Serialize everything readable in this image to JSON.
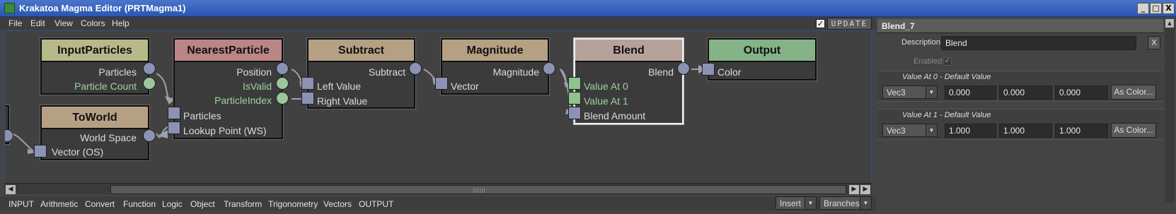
{
  "window": {
    "title": "Krakatoa Magma Editor (PRTMagma1)",
    "min_label": "_",
    "max_label": "□",
    "close_label": "X"
  },
  "menu": [
    "File",
    "Edit",
    "View",
    "Colors",
    "Help"
  ],
  "update": {
    "checked": true,
    "check_mark": "✓",
    "label": "UPDATE"
  },
  "colors": {
    "input_header": "#b8b98a",
    "nearest_header": "#bb8585",
    "subtract_header": "#b6a084",
    "magnitude_header": "#b6a084",
    "blend_header": "#b6a29a",
    "output_header": "#86b288",
    "toworld_header": "#b6a084"
  },
  "nodes": {
    "input_particles": {
      "title": "InputParticles",
      "outputs": [
        "Particles",
        "Particle Count"
      ]
    },
    "to_world": {
      "title": "ToWorld",
      "output": "World Space",
      "input": "Vector (OS)"
    },
    "nearest_particle": {
      "title": "NearestParticle",
      "outputs": [
        "Position",
        "IsValid",
        "ParticleIndex"
      ],
      "inputs": [
        "Particles",
        "Lookup Point (WS)"
      ]
    },
    "subtract": {
      "title": "Subtract",
      "output": "Subtract",
      "inputs": [
        "Left Value",
        "Right Value"
      ]
    },
    "magnitude": {
      "title": "Magnitude",
      "output": "Magnitude",
      "input": "Vector"
    },
    "blend": {
      "title": "Blend",
      "output": "Blend",
      "inputs": [
        "Value At 0",
        "Value At 1",
        "Blend Amount"
      ]
    },
    "output": {
      "title": "Output",
      "input": "Color"
    }
  },
  "scroll": {
    "left": "◀",
    "right": "▶"
  },
  "categories": [
    "INPUT",
    "Arithmetic",
    "Convert",
    "Function",
    "Logic",
    "Object",
    "Transform",
    "Trigonometry",
    "Vectors",
    "OUTPUT"
  ],
  "bottom": {
    "insert": "Insert",
    "branches": "Branches",
    "caret": "▼"
  },
  "properties": {
    "header": "Blend_7",
    "description_label": "Description",
    "description_value": "Blend",
    "x_label": "X",
    "enabled_label": "Enabled",
    "group0": {
      "title": "Value At 0 - Default Value",
      "type": "Vec3",
      "values": [
        "0.000",
        "0.000",
        "0.000"
      ],
      "button": "As Color..."
    },
    "group1": {
      "title": "Value At 1 - Default Value",
      "type": "Vec3",
      "values": [
        "1.000",
        "1.000",
        "1.000"
      ],
      "button": "As Color..."
    }
  }
}
